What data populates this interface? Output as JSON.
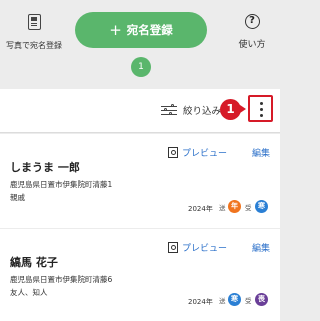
{
  "toolbar": {
    "photo_register_label": "写真で宛名登録",
    "main_button_label": "宛名登録",
    "help_label": "使い方",
    "help_glyph": "?",
    "count": "1"
  },
  "filterbar": {
    "filter_label": "絞り込み",
    "step_number": "1"
  },
  "contacts": [
    {
      "preview_label": "プレビュー",
      "edit_label": "編集",
      "name": "しまうま 一郎",
      "address": "鹿児島県日置市伊集院町清藤1",
      "relation": "親戚",
      "year": "2024年",
      "sent_label": "送",
      "sent_badge": "年",
      "sent_color": "#f0741e",
      "received_label": "受",
      "received_badge": "寒",
      "received_color": "#2a7fd4"
    },
    {
      "preview_label": "プレビュー",
      "edit_label": "編集",
      "name": "縞馬 花子",
      "address": "鹿児島県日置市伊集院町清藤6",
      "relation": "友人、知人",
      "year": "2024年",
      "sent_label": "送",
      "sent_badge": "寒",
      "sent_color": "#2a7fd4",
      "received_label": "受",
      "received_badge": "喪",
      "received_color": "#6a3f98"
    }
  ]
}
